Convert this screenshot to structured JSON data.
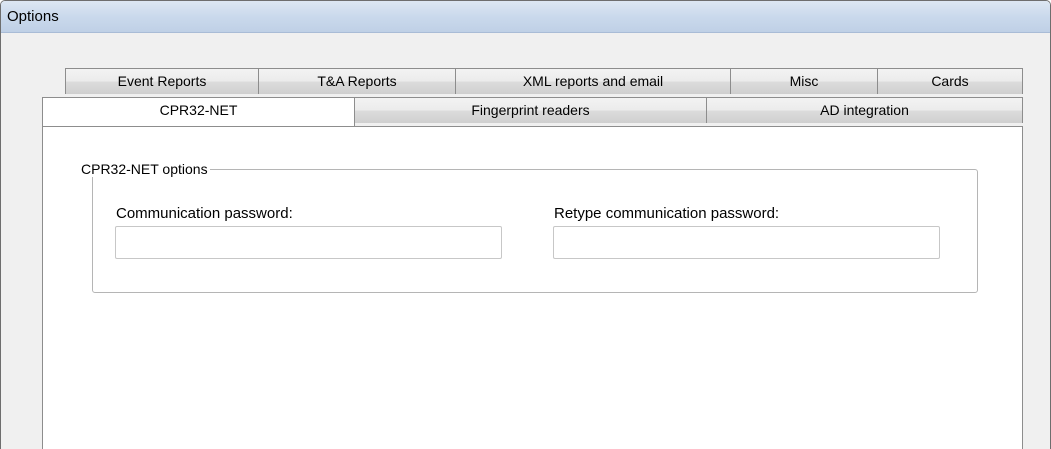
{
  "window": {
    "title": "Options"
  },
  "tabs": {
    "back_row": [
      {
        "id": "event-reports",
        "label": "Event Reports"
      },
      {
        "id": "ta-reports",
        "label": "T&A Reports"
      },
      {
        "id": "xml-reports",
        "label": "XML reports and email"
      },
      {
        "id": "misc",
        "label": "Misc"
      },
      {
        "id": "cards",
        "label": "Cards"
      }
    ],
    "front_row": [
      {
        "id": "cpr32-net",
        "label": "CPR32-NET"
      },
      {
        "id": "fingerprint-readers",
        "label": "Fingerprint readers"
      },
      {
        "id": "ad-integration",
        "label": "AD integration"
      }
    ],
    "selected": "CPR32-NET"
  },
  "cpr32_options": {
    "group_title": "CPR32-NET options",
    "password_label": "Communication password:",
    "password_value": "",
    "retype_label": "Retype communication password:",
    "retype_value": ""
  }
}
